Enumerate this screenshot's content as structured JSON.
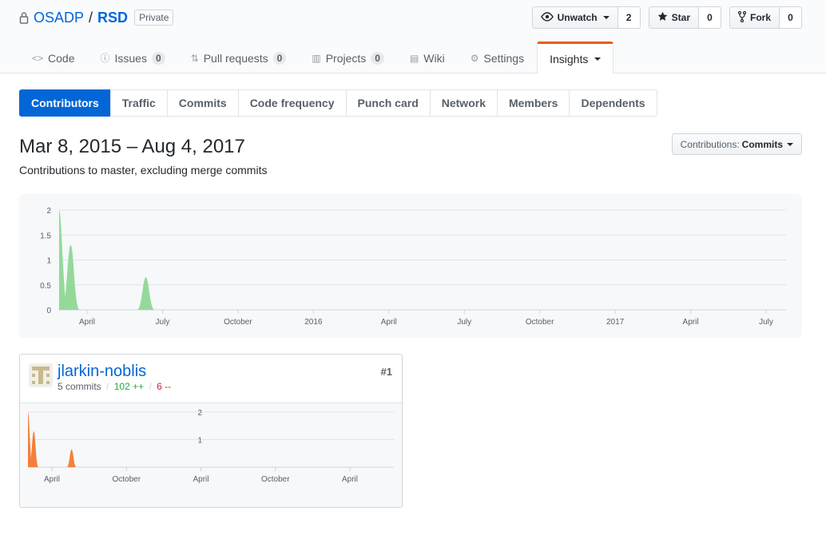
{
  "repo": {
    "owner": "OSADP",
    "separator": "/",
    "name": "RSD",
    "visibility": "Private"
  },
  "actions": [
    {
      "label": "Unwatch",
      "icon": "eye-icon",
      "count": "2",
      "caret": true
    },
    {
      "label": "Star",
      "icon": "star-icon",
      "count": "0",
      "caret": false
    },
    {
      "label": "Fork",
      "icon": "fork-icon",
      "count": "0",
      "caret": false
    }
  ],
  "nav": [
    {
      "label": "Code",
      "icon": "code-icon",
      "glyph": "<>"
    },
    {
      "label": "Issues",
      "icon": "issue-icon",
      "glyph": "ⓘ",
      "count": "0"
    },
    {
      "label": "Pull requests",
      "icon": "pull-request-icon",
      "glyph": "⇅",
      "count": "0"
    },
    {
      "label": "Projects",
      "icon": "project-icon",
      "glyph": "▥",
      "count": "0"
    },
    {
      "label": "Wiki",
      "icon": "book-icon",
      "glyph": "▤"
    },
    {
      "label": "Settings",
      "icon": "gear-icon",
      "glyph": "⚙"
    },
    {
      "label": "Insights",
      "icon": "",
      "glyph": "",
      "selected": true,
      "caret": true
    }
  ],
  "subnav": [
    "Contributors",
    "Traffic",
    "Commits",
    "Code frequency",
    "Punch card",
    "Network",
    "Members",
    "Dependents"
  ],
  "subnav_selected": "Contributors",
  "page": {
    "date_range": "Mar 8, 2015 – Aug 4, 2017",
    "subtitle": "Contributions to master, excluding merge commits",
    "contributions_label": "Contributions:",
    "contributions_value": "Commits"
  },
  "colors": {
    "accent": "#0366d6",
    "main_area": "#94d99a",
    "contrib_area": "#f4803a",
    "insights_border": "#e36209"
  },
  "chart_data": [
    {
      "type": "area",
      "ylim": [
        0,
        2
      ],
      "y_ticks": [
        "2",
        "1.5",
        "1",
        "0.5",
        "0"
      ],
      "x_ticks": [
        "April",
        "July",
        "October",
        "2016",
        "April",
        "July",
        "October",
        "2017",
        "April",
        "July"
      ],
      "series": [
        {
          "x": [
            "2015-03-08",
            "2015-03-22",
            "2015-06-21"
          ],
          "values": [
            2,
            1.3,
            0.65
          ]
        }
      ]
    },
    {
      "type": "area",
      "ylim": [
        0,
        2
      ],
      "y_ticks": [
        "2",
        "1"
      ],
      "x_ticks": [
        "April",
        "October",
        "April",
        "October",
        "April"
      ],
      "series": [
        {
          "x": [
            "2015-03-08",
            "2015-03-22",
            "2015-06-21"
          ],
          "values": [
            2,
            1.3,
            0.65
          ]
        }
      ]
    }
  ],
  "contributor": {
    "username": "jlarkin-noblis",
    "rank": "#1",
    "commits": "5 commits",
    "slash1": "/",
    "additions": "102 ++",
    "slash2": "/",
    "deletions": "6 --"
  }
}
